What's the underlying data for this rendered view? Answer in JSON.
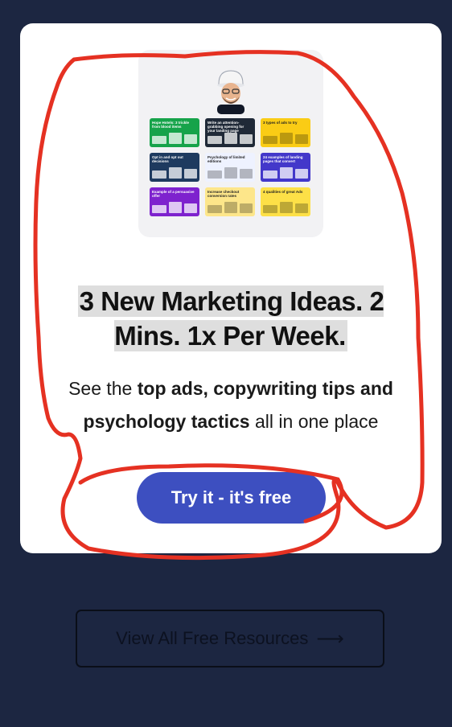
{
  "card": {
    "hero_thumbnails": [
      {
        "title": "Hope Hotels: 3 trickle from blood items",
        "bg": "#16a34a",
        "light": true
      },
      {
        "title": "Write an attention-grabbing opening for your landing page",
        "bg": "#1f2937",
        "light": true
      },
      {
        "title": "3 types of ads to try",
        "bg": "#facc15",
        "light": false
      },
      {
        "title": "Opt in and opt out decisions",
        "bg": "#1e3a5f",
        "light": true
      },
      {
        "title": "Psychology of limited editions",
        "bg": "#eef2ff",
        "light": false
      },
      {
        "title": "24 examples of landing pages that convert",
        "bg": "#4338ca",
        "light": true
      },
      {
        "title": "Example of a persuasive offer",
        "bg": "#7e22ce",
        "light": true
      },
      {
        "title": "Increase checkout conversion rates",
        "bg": "#fde68a",
        "light": false
      },
      {
        "title": "4 qualities of great Ads",
        "bg": "#fde047",
        "light": false
      }
    ],
    "headline": "3 New Marketing Ideas. 2 Mins. 1x Per Week.",
    "description": {
      "prefix": "See the ",
      "bold": "top ads, copywriting tips and psychology tactics",
      "suffix": " all in one place"
    },
    "cta_label": "Try it - it's free"
  },
  "secondary_button": {
    "label": "View All Free Resources",
    "arrow_icon": "arrow-right-icon"
  },
  "colors": {
    "page_bg": "#1c2641",
    "cta": "#3d4fc0",
    "annotation": "#e53122"
  }
}
